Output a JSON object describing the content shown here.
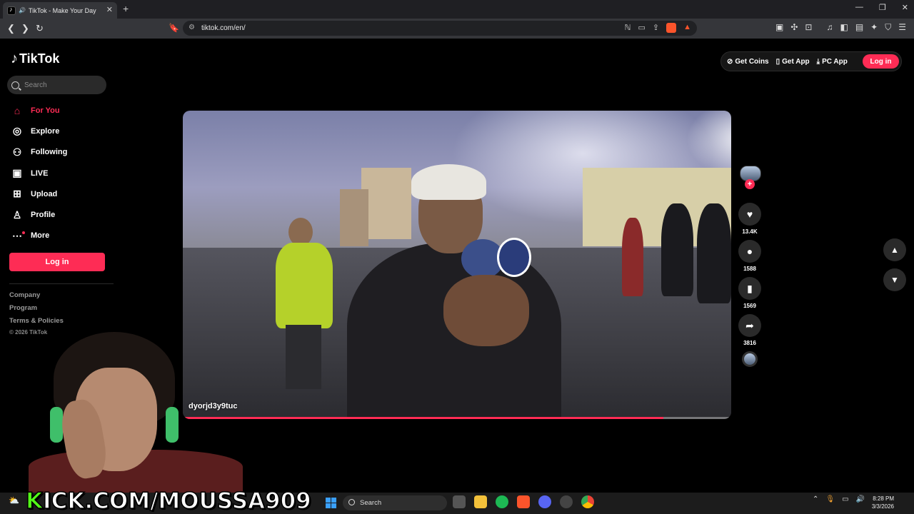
{
  "browser": {
    "tab_title": "TikTok - Make Your Day",
    "tab_close": "✕",
    "new_tab": "+",
    "url": "tiktok.com/en/",
    "window_controls": [
      "—",
      "❐",
      "✕"
    ]
  },
  "sidebar": {
    "logo": "TikTok",
    "search_placeholder": "Search",
    "items": [
      {
        "label": "For You",
        "icon": "home-icon",
        "glyph": "⌂",
        "active": true
      },
      {
        "label": "Explore",
        "icon": "compass-icon",
        "glyph": "◎",
        "active": false
      },
      {
        "label": "Following",
        "icon": "following-icon",
        "glyph": "⚇",
        "active": false
      },
      {
        "label": "LIVE",
        "icon": "live-icon",
        "glyph": "▣",
        "active": false
      },
      {
        "label": "Upload",
        "icon": "upload-icon",
        "glyph": "⊞",
        "active": false
      },
      {
        "label": "Profile",
        "icon": "profile-icon",
        "glyph": "♙",
        "active": false
      },
      {
        "label": "More",
        "icon": "more-icon",
        "glyph": "⋯",
        "active": false
      }
    ],
    "login_label": "Log in",
    "footer_links": [
      "Company",
      "Program",
      "Terms & Policies"
    ],
    "copyright": "© 2026 TikTok"
  },
  "topbar": {
    "get_coins": "Get Coins",
    "get_app": "Get App",
    "pc_app": "PC App",
    "login": "Log in"
  },
  "video": {
    "username": "dyorjd3y9tuc",
    "progress": 0.876
  },
  "actions": {
    "likes": "13.4K",
    "comments": "1588",
    "saves": "1569",
    "shares": "3816"
  },
  "overlay": {
    "kick_text": "KICK.COM/MOUSSA909"
  },
  "taskbar": {
    "search_placeholder": "Search",
    "time": "8:28 PM",
    "date": "3/3/2026"
  },
  "colors": {
    "accent": "#fe2c55",
    "kick_green": "#53fc18"
  }
}
